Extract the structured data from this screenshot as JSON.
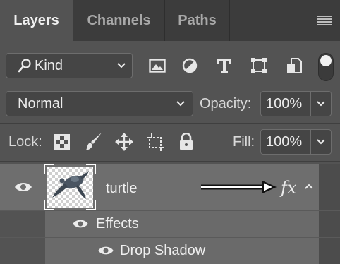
{
  "tabs": [
    {
      "label": "Layers",
      "active": true
    },
    {
      "label": "Channels",
      "active": false
    },
    {
      "label": "Paths",
      "active": false
    }
  ],
  "filter": {
    "kind_label": "Kind",
    "icons": [
      "image-filter-icon",
      "adjustment-filter-icon",
      "type-filter-icon",
      "shape-filter-icon",
      "smart-object-filter-icon"
    ]
  },
  "blend": {
    "mode": "Normal",
    "opacity_label": "Opacity:",
    "opacity_value": "100%"
  },
  "lock": {
    "label": "Lock:",
    "fill_label": "Fill:",
    "fill_value": "100%"
  },
  "layer": {
    "name": "turtle",
    "fx": "fx"
  },
  "effects": {
    "header": "Effects",
    "items": [
      "Drop Shadow"
    ]
  },
  "colors": {
    "panel": "#535353",
    "selected_row": "#6e6e6e",
    "tab_bar": "#3c3c3c"
  }
}
